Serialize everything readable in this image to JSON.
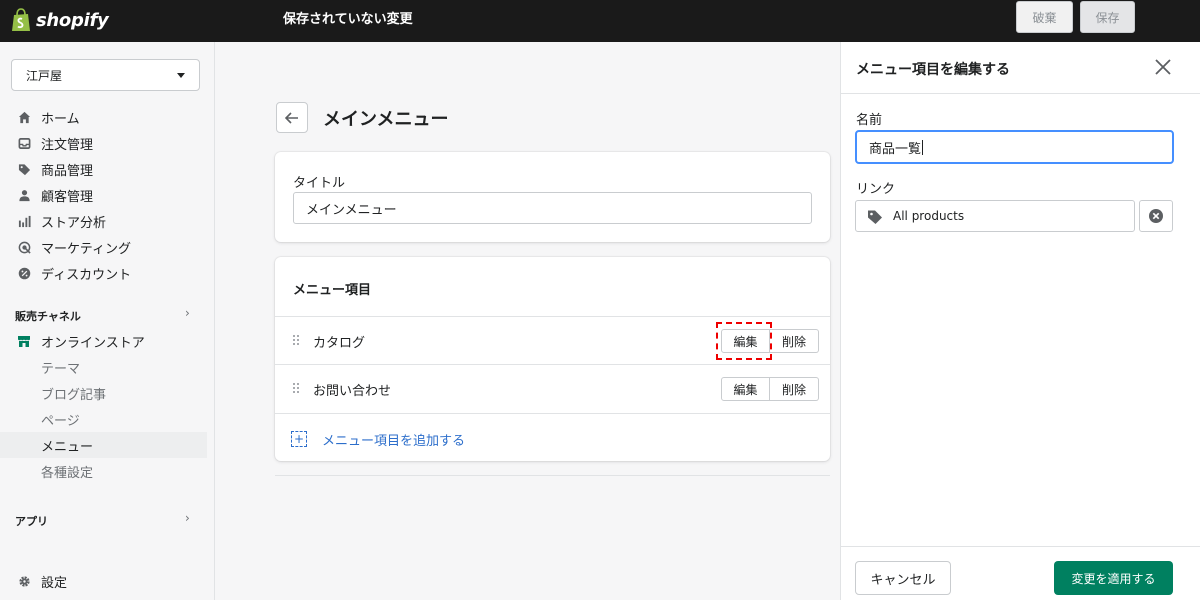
{
  "topbar": {
    "logo_text": "shopify",
    "unsaved_message": "保存されていない変更",
    "discard_label": "破棄",
    "save_label": "保存"
  },
  "sidebar": {
    "store_name": "江戸屋",
    "nav": [
      {
        "label": "ホーム",
        "icon": "home-icon"
      },
      {
        "label": "注文管理",
        "icon": "inbox-icon"
      },
      {
        "label": "商品管理",
        "icon": "tag-icon"
      },
      {
        "label": "顧客管理",
        "icon": "person-icon"
      },
      {
        "label": "ストア分析",
        "icon": "bar-chart-icon"
      },
      {
        "label": "マーケティング",
        "icon": "target-icon"
      },
      {
        "label": "ディスカウント",
        "icon": "discount-icon"
      }
    ],
    "sales_channels_heading": "販売チャネル",
    "online_store_label": "オンラインストア",
    "sub_items": [
      "テーマ",
      "ブログ記事",
      "ページ",
      "メニュー",
      "各種設定"
    ],
    "apps_heading": "アプリ",
    "settings_label": "設定"
  },
  "main": {
    "page_title": "メインメニュー",
    "title_card": {
      "label": "タイトル",
      "value": "メインメニュー"
    },
    "menu_items_card": {
      "title": "メニュー項目",
      "items": [
        {
          "label": "カタログ",
          "edit": "編集",
          "delete": "削除"
        },
        {
          "label": "お問い合わせ",
          "edit": "編集",
          "delete": "削除"
        }
      ],
      "add_label": "メニュー項目を追加する"
    }
  },
  "panel": {
    "title": "メニュー項目を編集する",
    "name_label": "名前",
    "name_value": "商品一覧",
    "link_label": "リンク",
    "link_value": "All products",
    "cancel_label": "キャンセル",
    "apply_label": "変更を適用する"
  },
  "colors": {
    "topbar_bg": "#1a1a1a",
    "primary_green": "#008060",
    "link_blue": "#2c6ecb",
    "focus_blue": "#458fff",
    "highlight_red": "#e00000"
  }
}
